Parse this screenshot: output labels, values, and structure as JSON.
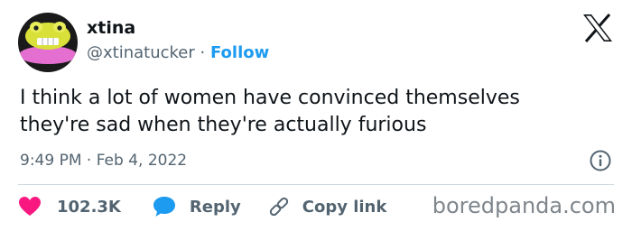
{
  "user": {
    "display_name": "xtina",
    "handle": "@xtinatucker",
    "separator": "·",
    "follow_label": "Follow"
  },
  "tweet": {
    "text_line1": "I think a lot of women have convinced themselves",
    "text_line2": "they're sad when they're actually furious",
    "timestamp": "9:49 PM · Feb 4, 2022"
  },
  "actions": {
    "likes_count": "102.3K",
    "reply_label": "Reply",
    "copy_link_label": "Copy link"
  },
  "watermark": "boredpanda.com",
  "icons": {
    "brand": "x-logo-icon",
    "info": "info-icon",
    "like": "heart-icon",
    "reply": "speech-bubble-icon",
    "copy": "link-icon"
  },
  "colors": {
    "accent": "#1d9bf0",
    "like": "#f91880",
    "secondary_text": "#536471"
  }
}
